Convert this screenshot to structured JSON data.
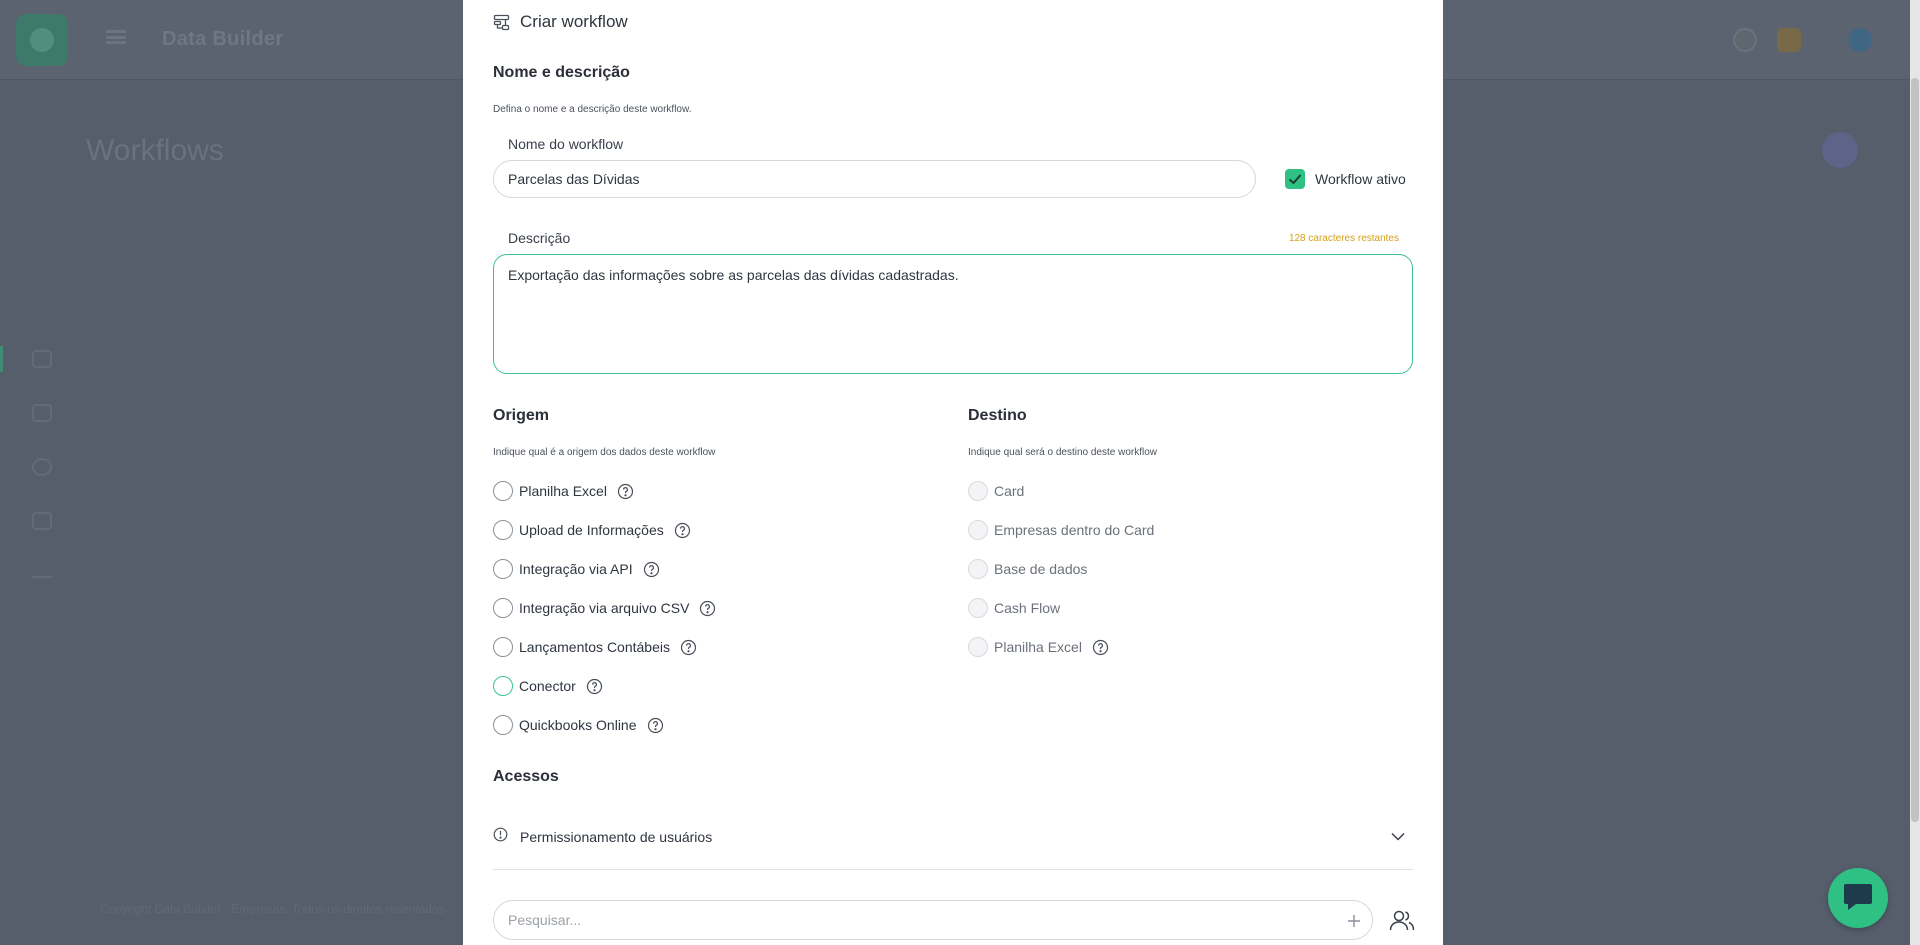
{
  "background": {
    "app_title": "Data Builder",
    "page_title": "Workflows",
    "footer_text": "Copyright Data Builder - Empresas. Todos os direitos reservados"
  },
  "modal": {
    "title": "Criar workflow",
    "name_section": {
      "title": "Nome e descrição",
      "description": "Defina o nome e a descrição deste workflow.",
      "name_label": "Nome do workflow",
      "name_value": "Parcelas das Dívidas",
      "active_label": "Workflow ativo",
      "active_checked": true,
      "description_label": "Descrição",
      "chars_remaining": "128 caracteres restantes",
      "description_value": "Exportação das informações sobre as parcelas das dívidas cadastradas."
    },
    "origin": {
      "title": "Origem",
      "description": "Indique qual é a origem dos dados deste workflow",
      "options": [
        {
          "label": "Planilha Excel",
          "help": true
        },
        {
          "label": "Upload de Informações",
          "help": true
        },
        {
          "label": "Integração via API",
          "help": true
        },
        {
          "label": "Integração via arquivo CSV",
          "help": true
        },
        {
          "label": "Lançamentos Contábeis",
          "help": true
        },
        {
          "label": "Conector",
          "help": true
        },
        {
          "label": "Quickbooks Online",
          "help": true
        }
      ]
    },
    "destination": {
      "title": "Destino",
      "description": "Indique qual será o destino deste workflow",
      "options": [
        {
          "label": "Card",
          "help": false
        },
        {
          "label": "Empresas dentro do Card",
          "help": false
        },
        {
          "label": "Base de dados",
          "help": false
        },
        {
          "label": "Cash Flow",
          "help": false
        },
        {
          "label": "Planilha Excel",
          "help": true
        }
      ]
    },
    "access": {
      "title": "Acessos",
      "permissions_label": "Permissionamento de usuários",
      "search_placeholder": "Pesquisar..."
    }
  },
  "colors": {
    "accent": "#2fc183",
    "overlay": "#565e6c",
    "warning": "#d4a017"
  },
  "icons": {
    "title": "workflow-icon",
    "help": "question-circle-icon",
    "info": "info-circle-icon",
    "chevron": "chevron-down-icon",
    "add": "plus-icon",
    "users": "users-icon",
    "chat": "chat-bubble-icon"
  }
}
